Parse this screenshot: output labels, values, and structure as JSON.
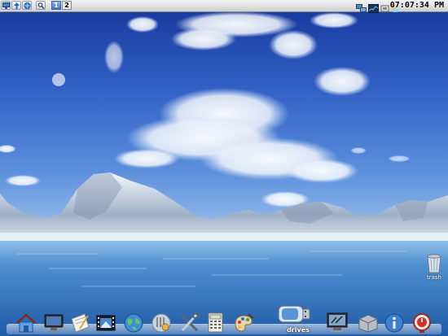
{
  "top_panel": {
    "workspaces": [
      "1",
      "2"
    ],
    "active_workspace": "1",
    "clock": "07:07:34 PM"
  },
  "desktop_icons": {
    "trash_label": "trash"
  },
  "dock": {
    "drives_label": "drives",
    "items": [
      "home-icon",
      "monitor-icon",
      "text-editor-icon",
      "film-icon",
      "globe-icon",
      "mixer-icon",
      "tools-icon",
      "calculator-icon",
      "paint-palette-icon",
      "usb-drive-icon",
      "system-monitor-icon",
      "package-icon",
      "info-icon",
      "power-icon"
    ]
  },
  "colors": {
    "sky_top": "#1d3f9e",
    "sky_bottom": "#8fb8e8",
    "water": "#3a7ac2",
    "active_workspace": "#3e72c4"
  }
}
